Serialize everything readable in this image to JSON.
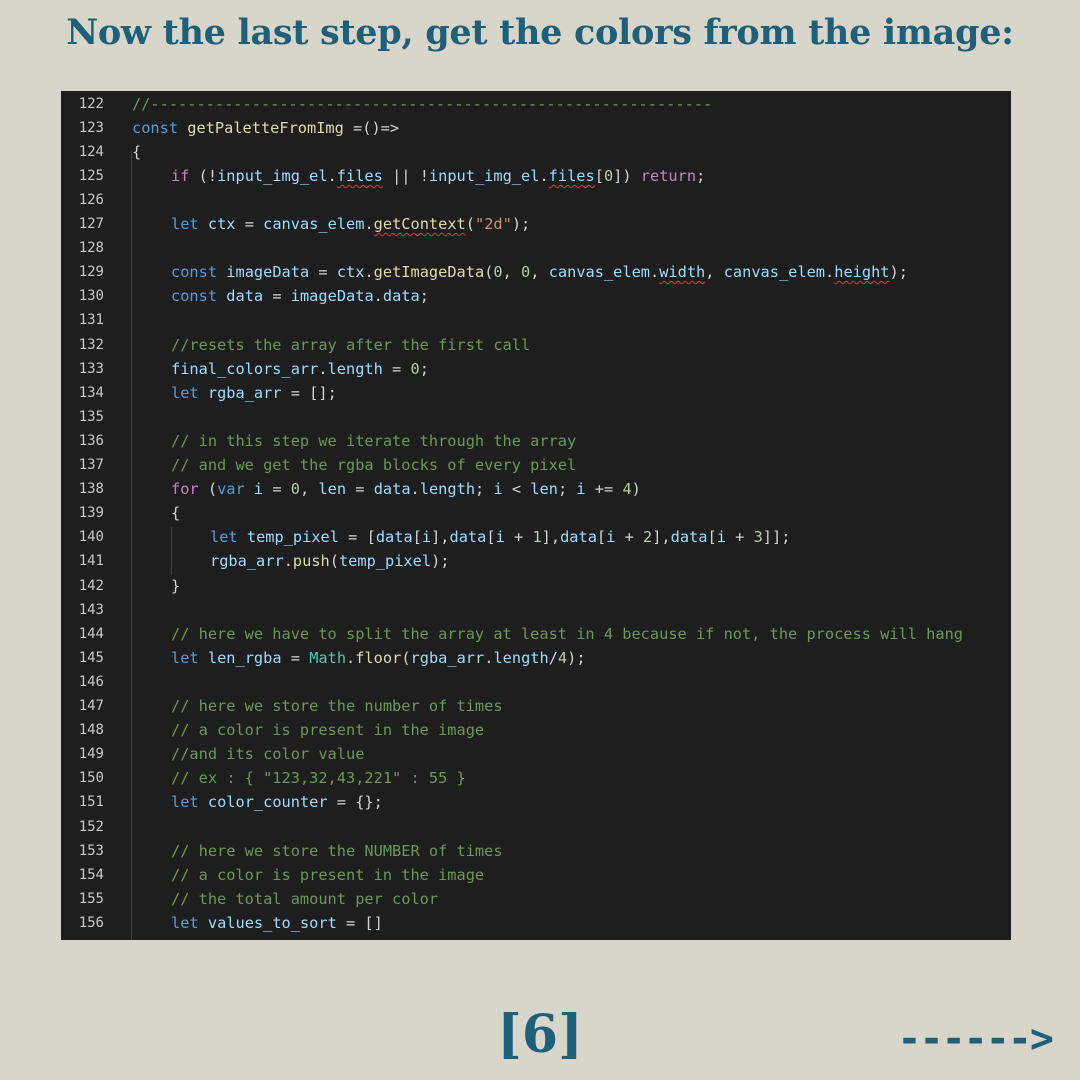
{
  "title": "Now the last step, get the colors from the image:",
  "page_number": "[6]",
  "next_arrow": "------>",
  "colors": {
    "background": "#d8d6ca",
    "accent": "#1e5f7a",
    "editor_background": "#1e1e1e"
  },
  "editor": {
    "lines": [
      {
        "n": "122",
        "indent": 0,
        "tokens": [
          {
            "t": "//-------------------------------------------------------------",
            "c": "com"
          }
        ]
      },
      {
        "n": "123",
        "indent": 0,
        "tokens": [
          {
            "t": "const",
            "c": "kw"
          },
          {
            "t": " ",
            "c": "plain"
          },
          {
            "t": "getPaletteFromImg",
            "c": "fn"
          },
          {
            "t": " =()=>",
            "c": "plain"
          }
        ]
      },
      {
        "n": "124",
        "indent": 0,
        "tokens": [
          {
            "t": "{",
            "c": "plain"
          }
        ]
      },
      {
        "n": "125",
        "indent": 1,
        "tokens": [
          {
            "t": "if",
            "c": "cf"
          },
          {
            "t": " (!",
            "c": "plain"
          },
          {
            "t": "input_img_el",
            "c": "var"
          },
          {
            "t": ".",
            "c": "plain"
          },
          {
            "t": "files",
            "c": "var",
            "sq": true
          },
          {
            "t": " || !",
            "c": "plain"
          },
          {
            "t": "input_img_el",
            "c": "var"
          },
          {
            "t": ".",
            "c": "plain"
          },
          {
            "t": "files",
            "c": "var",
            "sq": true
          },
          {
            "t": "[",
            "c": "plain"
          },
          {
            "t": "0",
            "c": "num"
          },
          {
            "t": "]) ",
            "c": "plain"
          },
          {
            "t": "return",
            "c": "cf"
          },
          {
            "t": ";",
            "c": "plain"
          }
        ]
      },
      {
        "n": "126",
        "indent": 0,
        "tokens": []
      },
      {
        "n": "127",
        "indent": 1,
        "tokens": [
          {
            "t": "let",
            "c": "kw"
          },
          {
            "t": " ",
            "c": "plain"
          },
          {
            "t": "ctx",
            "c": "var"
          },
          {
            "t": " = ",
            "c": "plain"
          },
          {
            "t": "canvas_elem",
            "c": "var"
          },
          {
            "t": ".",
            "c": "plain"
          },
          {
            "t": "getContext",
            "c": "fn",
            "sq": true
          },
          {
            "t": "(",
            "c": "plain"
          },
          {
            "t": "\"2d\"",
            "c": "str"
          },
          {
            "t": ");",
            "c": "plain"
          }
        ]
      },
      {
        "n": "128",
        "indent": 0,
        "tokens": []
      },
      {
        "n": "129",
        "indent": 1,
        "tokens": [
          {
            "t": "const",
            "c": "kw"
          },
          {
            "t": " ",
            "c": "plain"
          },
          {
            "t": "imageData",
            "c": "var"
          },
          {
            "t": " = ",
            "c": "plain"
          },
          {
            "t": "ctx",
            "c": "var"
          },
          {
            "t": ".",
            "c": "plain"
          },
          {
            "t": "getImageData",
            "c": "fn"
          },
          {
            "t": "(",
            "c": "plain"
          },
          {
            "t": "0",
            "c": "num"
          },
          {
            "t": ", ",
            "c": "plain"
          },
          {
            "t": "0",
            "c": "num"
          },
          {
            "t": ", ",
            "c": "plain"
          },
          {
            "t": "canvas_elem",
            "c": "var"
          },
          {
            "t": ".",
            "c": "plain"
          },
          {
            "t": "width",
            "c": "var",
            "sq": true
          },
          {
            "t": ", ",
            "c": "plain"
          },
          {
            "t": "canvas_elem",
            "c": "var"
          },
          {
            "t": ".",
            "c": "plain"
          },
          {
            "t": "height",
            "c": "var",
            "sq": true
          },
          {
            "t": ");",
            "c": "plain"
          }
        ]
      },
      {
        "n": "130",
        "indent": 1,
        "tokens": [
          {
            "t": "const",
            "c": "kw"
          },
          {
            "t": " ",
            "c": "plain"
          },
          {
            "t": "data",
            "c": "var"
          },
          {
            "t": " = ",
            "c": "plain"
          },
          {
            "t": "imageData",
            "c": "var"
          },
          {
            "t": ".",
            "c": "plain"
          },
          {
            "t": "data",
            "c": "var"
          },
          {
            "t": ";",
            "c": "plain"
          }
        ]
      },
      {
        "n": "131",
        "indent": 0,
        "tokens": []
      },
      {
        "n": "132",
        "indent": 1,
        "tokens": [
          {
            "t": "//resets the array after the first call",
            "c": "com"
          }
        ]
      },
      {
        "n": "133",
        "indent": 1,
        "tokens": [
          {
            "t": "final_colors_arr",
            "c": "var"
          },
          {
            "t": ".",
            "c": "plain"
          },
          {
            "t": "length",
            "c": "var"
          },
          {
            "t": " = ",
            "c": "plain"
          },
          {
            "t": "0",
            "c": "num"
          },
          {
            "t": ";",
            "c": "plain"
          }
        ]
      },
      {
        "n": "134",
        "indent": 1,
        "tokens": [
          {
            "t": "let",
            "c": "kw"
          },
          {
            "t": " ",
            "c": "plain"
          },
          {
            "t": "rgba_arr",
            "c": "var"
          },
          {
            "t": " = [];",
            "c": "plain"
          }
        ]
      },
      {
        "n": "135",
        "indent": 0,
        "tokens": []
      },
      {
        "n": "136",
        "indent": 1,
        "tokens": [
          {
            "t": "// in this step we iterate through the array",
            "c": "com"
          }
        ]
      },
      {
        "n": "137",
        "indent": 1,
        "tokens": [
          {
            "t": "// and we get the rgba blocks of every pixel",
            "c": "com"
          }
        ]
      },
      {
        "n": "138",
        "indent": 1,
        "tokens": [
          {
            "t": "for",
            "c": "cf"
          },
          {
            "t": " (",
            "c": "plain"
          },
          {
            "t": "var",
            "c": "kw"
          },
          {
            "t": " ",
            "c": "plain"
          },
          {
            "t": "i",
            "c": "var"
          },
          {
            "t": " = ",
            "c": "plain"
          },
          {
            "t": "0",
            "c": "num"
          },
          {
            "t": ", ",
            "c": "plain"
          },
          {
            "t": "len",
            "c": "var"
          },
          {
            "t": " = ",
            "c": "plain"
          },
          {
            "t": "data",
            "c": "var"
          },
          {
            "t": ".",
            "c": "plain"
          },
          {
            "t": "length",
            "c": "var"
          },
          {
            "t": "; ",
            "c": "plain"
          },
          {
            "t": "i",
            "c": "var"
          },
          {
            "t": " < ",
            "c": "plain"
          },
          {
            "t": "len",
            "c": "var"
          },
          {
            "t": "; ",
            "c": "plain"
          },
          {
            "t": "i",
            "c": "var"
          },
          {
            "t": " += ",
            "c": "plain"
          },
          {
            "t": "4",
            "c": "num"
          },
          {
            "t": ")",
            "c": "plain"
          }
        ]
      },
      {
        "n": "139",
        "indent": 1,
        "tokens": [
          {
            "t": "{",
            "c": "plain"
          }
        ]
      },
      {
        "n": "140",
        "indent": 2,
        "tokens": [
          {
            "t": "let",
            "c": "kw"
          },
          {
            "t": " ",
            "c": "plain"
          },
          {
            "t": "temp_pixel",
            "c": "var"
          },
          {
            "t": " = [",
            "c": "plain"
          },
          {
            "t": "data",
            "c": "var"
          },
          {
            "t": "[",
            "c": "plain"
          },
          {
            "t": "i",
            "c": "var"
          },
          {
            "t": "],",
            "c": "plain"
          },
          {
            "t": "data",
            "c": "var"
          },
          {
            "t": "[",
            "c": "plain"
          },
          {
            "t": "i",
            "c": "var"
          },
          {
            "t": " + ",
            "c": "plain"
          },
          {
            "t": "1",
            "c": "num"
          },
          {
            "t": "],",
            "c": "plain"
          },
          {
            "t": "data",
            "c": "var"
          },
          {
            "t": "[",
            "c": "plain"
          },
          {
            "t": "i",
            "c": "var"
          },
          {
            "t": " + ",
            "c": "plain"
          },
          {
            "t": "2",
            "c": "num"
          },
          {
            "t": "],",
            "c": "plain"
          },
          {
            "t": "data",
            "c": "var"
          },
          {
            "t": "[",
            "c": "plain"
          },
          {
            "t": "i",
            "c": "var"
          },
          {
            "t": " + ",
            "c": "plain"
          },
          {
            "t": "3",
            "c": "num"
          },
          {
            "t": "]];",
            "c": "plain"
          }
        ]
      },
      {
        "n": "141",
        "indent": 2,
        "tokens": [
          {
            "t": "rgba_arr",
            "c": "var"
          },
          {
            "t": ".",
            "c": "plain"
          },
          {
            "t": "push",
            "c": "fn"
          },
          {
            "t": "(",
            "c": "plain"
          },
          {
            "t": "temp_pixel",
            "c": "var"
          },
          {
            "t": ");",
            "c": "plain"
          }
        ]
      },
      {
        "n": "142",
        "indent": 1,
        "tokens": [
          {
            "t": "}",
            "c": "plain"
          }
        ]
      },
      {
        "n": "143",
        "indent": 0,
        "tokens": []
      },
      {
        "n": "144",
        "indent": 1,
        "tokens": [
          {
            "t": "// here we have to split the array at least in 4 because if not, the process will hang",
            "c": "com"
          }
        ]
      },
      {
        "n": "145",
        "indent": 1,
        "tokens": [
          {
            "t": "let",
            "c": "kw"
          },
          {
            "t": " ",
            "c": "plain"
          },
          {
            "t": "len_rgba",
            "c": "var"
          },
          {
            "t": " = ",
            "c": "plain"
          },
          {
            "t": "Math",
            "c": "cls"
          },
          {
            "t": ".",
            "c": "plain"
          },
          {
            "t": "floor",
            "c": "fn"
          },
          {
            "t": "(",
            "c": "plain"
          },
          {
            "t": "rgba_arr",
            "c": "var"
          },
          {
            "t": ".",
            "c": "plain"
          },
          {
            "t": "length",
            "c": "var"
          },
          {
            "t": "/",
            "c": "plain"
          },
          {
            "t": "4",
            "c": "num"
          },
          {
            "t": ");",
            "c": "plain"
          }
        ]
      },
      {
        "n": "146",
        "indent": 0,
        "tokens": []
      },
      {
        "n": "147",
        "indent": 1,
        "tokens": [
          {
            "t": "// here we store the number of times",
            "c": "com"
          }
        ]
      },
      {
        "n": "148",
        "indent": 1,
        "tokens": [
          {
            "t": "// a color is present in the image",
            "c": "com"
          }
        ]
      },
      {
        "n": "149",
        "indent": 1,
        "tokens": [
          {
            "t": "//and its color value",
            "c": "com"
          }
        ]
      },
      {
        "n": "150",
        "indent": 1,
        "tokens": [
          {
            "t": "// ex : { \"123,32,43,221\" : 55 }",
            "c": "com"
          }
        ]
      },
      {
        "n": "151",
        "indent": 1,
        "tokens": [
          {
            "t": "let",
            "c": "kw"
          },
          {
            "t": " ",
            "c": "plain"
          },
          {
            "t": "color_counter",
            "c": "var"
          },
          {
            "t": " = {};",
            "c": "plain"
          }
        ]
      },
      {
        "n": "152",
        "indent": 0,
        "tokens": []
      },
      {
        "n": "153",
        "indent": 1,
        "tokens": [
          {
            "t": "// here we store the NUMBER of times",
            "c": "com"
          }
        ]
      },
      {
        "n": "154",
        "indent": 1,
        "tokens": [
          {
            "t": "// a color is present in the image",
            "c": "com"
          }
        ]
      },
      {
        "n": "155",
        "indent": 1,
        "tokens": [
          {
            "t": "// the total amount per color",
            "c": "com"
          }
        ]
      },
      {
        "n": "156",
        "indent": 1,
        "tokens": [
          {
            "t": "let",
            "c": "kw"
          },
          {
            "t": " ",
            "c": "plain"
          },
          {
            "t": "values_to_sort",
            "c": "var"
          },
          {
            "t": " = []",
            "c": "plain"
          }
        ]
      }
    ]
  }
}
